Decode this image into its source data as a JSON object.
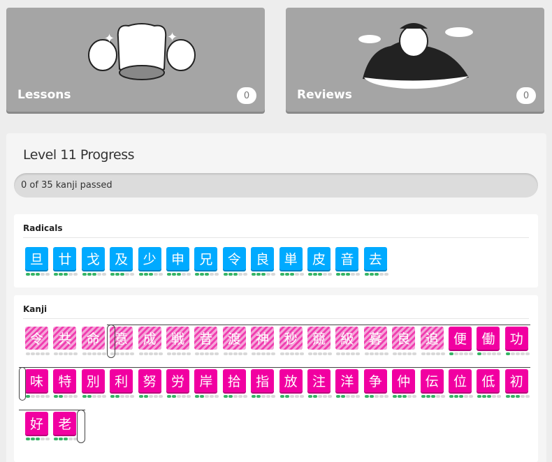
{
  "lessons": {
    "label": "Lessons",
    "count": "0"
  },
  "reviews": {
    "label": "Reviews",
    "count": "0"
  },
  "progress": {
    "title": "Level 11 Progress",
    "bar_text": "0 of 35 kanji passed",
    "fraction": 0,
    "radicals_title": "Radicals",
    "kanji_title": "Kanji"
  },
  "colors": {
    "radical": "#00aaff",
    "kanji": "#f100a1",
    "pip_on": "#37b466",
    "card": "#a5a5a5"
  },
  "radicals": [
    {
      "char": "旦",
      "level": 3
    },
    {
      "char": "廿",
      "level": 3
    },
    {
      "char": "戈",
      "level": 3
    },
    {
      "char": "及",
      "level": 3
    },
    {
      "char": "少",
      "level": 3
    },
    {
      "char": "申",
      "level": 3
    },
    {
      "char": "兄",
      "level": 3
    },
    {
      "char": "令",
      "level": 3
    },
    {
      "char": "良",
      "level": 3
    },
    {
      "char": "単",
      "level": 3
    },
    {
      "char": "皮",
      "level": 3
    },
    {
      "char": "音",
      "level": 3
    },
    {
      "char": "去",
      "level": 3
    }
  ],
  "kanji": [
    {
      "char": "令",
      "level": 0,
      "locked": true
    },
    {
      "char": "共",
      "level": 0,
      "locked": true
    },
    {
      "char": "命",
      "level": 0,
      "locked": true
    },
    {
      "char": "意",
      "level": 0,
      "locked": true
    },
    {
      "char": "成",
      "level": 0,
      "locked": true
    },
    {
      "char": "戦",
      "level": 0,
      "locked": true
    },
    {
      "char": "昔",
      "level": 0,
      "locked": true
    },
    {
      "char": "渡",
      "level": 0,
      "locked": true
    },
    {
      "char": "神",
      "level": 0,
      "locked": true
    },
    {
      "char": "秒",
      "level": 0,
      "locked": true
    },
    {
      "char": "競",
      "level": 0,
      "locked": true
    },
    {
      "char": "級",
      "level": 0,
      "locked": true
    },
    {
      "char": "暮",
      "level": 0,
      "locked": true
    },
    {
      "char": "良",
      "level": 0,
      "locked": true
    },
    {
      "char": "追",
      "level": 0,
      "locked": true
    },
    {
      "char": "便",
      "level": 1,
      "locked": false
    },
    {
      "char": "働",
      "level": 1,
      "locked": false
    },
    {
      "char": "功",
      "level": 1,
      "locked": false
    },
    {
      "char": "味",
      "level": 1,
      "locked": false
    },
    {
      "char": "特",
      "level": 2,
      "locked": false
    },
    {
      "char": "別",
      "level": 2,
      "locked": false
    },
    {
      "char": "利",
      "level": 2,
      "locked": false
    },
    {
      "char": "努",
      "level": 2,
      "locked": false
    },
    {
      "char": "労",
      "level": 2,
      "locked": false
    },
    {
      "char": "岸",
      "level": 2,
      "locked": false
    },
    {
      "char": "拾",
      "level": 2,
      "locked": false
    },
    {
      "char": "指",
      "level": 2,
      "locked": false
    },
    {
      "char": "放",
      "level": 2,
      "locked": false
    },
    {
      "char": "注",
      "level": 2,
      "locked": false
    },
    {
      "char": "洋",
      "level": 2,
      "locked": false
    },
    {
      "char": "争",
      "level": 2,
      "locked": false
    },
    {
      "char": "仲",
      "level": 3,
      "locked": false
    },
    {
      "char": "伝",
      "level": 3,
      "locked": false
    },
    {
      "char": "位",
      "level": 3,
      "locked": false
    },
    {
      "char": "低",
      "level": 3,
      "locked": false
    },
    {
      "char": "初",
      "level": 3,
      "locked": false
    },
    {
      "char": "好",
      "level": 3,
      "locked": false
    },
    {
      "char": "老",
      "level": 3,
      "locked": false
    }
  ]
}
